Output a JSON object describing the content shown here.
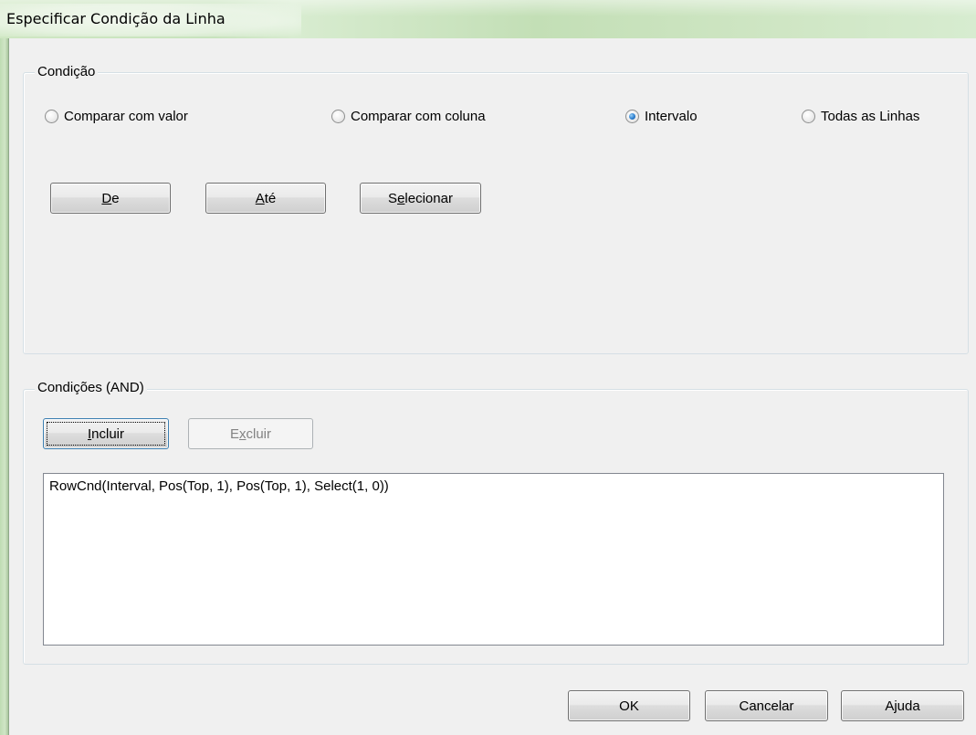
{
  "window": {
    "title": "Especificar Condição da Linha"
  },
  "condition_group": {
    "label": "Condição",
    "radios": [
      {
        "label": "Comparar com valor",
        "checked": false
      },
      {
        "label": "Comparar com coluna",
        "checked": false
      },
      {
        "label": "Intervalo",
        "checked": true
      },
      {
        "label": "Todas as Linhas",
        "checked": false
      }
    ],
    "buttons": {
      "from": {
        "mnemonic": "D",
        "rest": "e"
      },
      "to": {
        "mnemonic": "A",
        "rest": "té"
      },
      "select": {
        "prefix": "S",
        "mnemonic": "e",
        "rest": "lecionar"
      }
    }
  },
  "conditions_and_group": {
    "label": "Condições (AND)",
    "buttons": {
      "include": {
        "mnemonic": "I",
        "rest": "ncluir"
      },
      "delete": {
        "prefix": "E",
        "mnemonic": "x",
        "rest": "cluir",
        "enabled": false
      }
    },
    "list_items": [
      "RowCnd(Interval, Pos(Top, 1), Pos(Top, 1), Select(1, 0))"
    ]
  },
  "footer": {
    "ok": "OK",
    "cancel": "Cancelar",
    "help": "Ajuda"
  },
  "colors": {
    "dialog_bg": "#f0f0f0",
    "titlebar_glass": "#cfe7c3",
    "radio_selected": "#2c7fd0"
  }
}
